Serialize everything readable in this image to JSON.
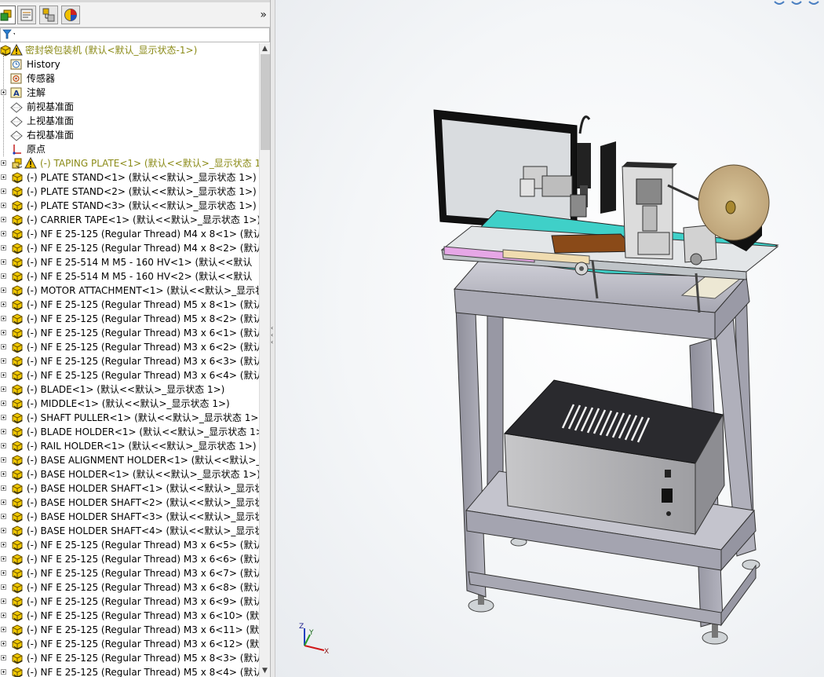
{
  "tree": {
    "root_label": "密封袋包装机 (默认<默认_显示状态-1>)",
    "items": [
      {
        "label": "History",
        "icon": "history-icon",
        "expandable": false
      },
      {
        "label": "传感器",
        "icon": "sensor-icon",
        "expandable": false
      },
      {
        "label": "注解",
        "icon": "annotation-icon",
        "expandable": true
      },
      {
        "label": "前视基准面",
        "icon": "plane-icon",
        "expandable": false
      },
      {
        "label": "上视基准面",
        "icon": "plane-icon",
        "expandable": false
      },
      {
        "label": "右视基准面",
        "icon": "plane-icon",
        "expandable": false
      },
      {
        "label": "原点",
        "icon": "origin-icon",
        "expandable": false
      },
      {
        "label": "(-) TAPING PLATE<1> (默认<<默认>_显示状态 1>",
        "icon": "subassembly-icon",
        "expandable": true,
        "warning": true
      },
      {
        "label": "(-) PLATE STAND<1> (默认<<默认>_显示状态 1>)",
        "icon": "part-icon",
        "expandable": true
      },
      {
        "label": "(-) PLATE STAND<2> (默认<<默认>_显示状态 1>)",
        "icon": "part-icon",
        "expandable": true
      },
      {
        "label": "(-) PLATE STAND<3> (默认<<默认>_显示状态 1>)",
        "icon": "part-icon",
        "expandable": true
      },
      {
        "label": "(-) CARRIER TAPE<1> (默认<<默认>_显示状态 1>)",
        "icon": "part-icon",
        "expandable": true
      },
      {
        "label": "(-) NF E 25-125  (Regular Thread) M4 x 8<1> (默认",
        "icon": "part-icon",
        "expandable": true
      },
      {
        "label": "(-) NF E 25-125  (Regular Thread) M4 x 8<2> (默认",
        "icon": "part-icon",
        "expandable": true
      },
      {
        "label": "(-) NF E 25-514  M M5  -  160 HV<1> (默认<<默认",
        "icon": "part-icon",
        "expandable": true
      },
      {
        "label": "(-) NF E 25-514  M M5  -  160 HV<2> (默认<<默认",
        "icon": "part-icon",
        "expandable": true
      },
      {
        "label": "(-) MOTOR ATTACHMENT<1> (默认<<默认>_显示状",
        "icon": "part-icon",
        "expandable": true
      },
      {
        "label": "(-) NF E 25-125  (Regular Thread) M5 x 8<1> (默认",
        "icon": "part-icon",
        "expandable": true
      },
      {
        "label": "(-) NF E 25-125  (Regular Thread) M5 x 8<2> (默认",
        "icon": "part-icon",
        "expandable": true
      },
      {
        "label": "(-) NF E 25-125  (Regular Thread) M3 x 6<1> (默认",
        "icon": "part-icon",
        "expandable": true
      },
      {
        "label": "(-) NF E 25-125  (Regular Thread) M3 x 6<2> (默认",
        "icon": "part-icon",
        "expandable": true
      },
      {
        "label": "(-) NF E 25-125  (Regular Thread) M3 x 6<3> (默认",
        "icon": "part-icon",
        "expandable": true
      },
      {
        "label": "(-) NF E 25-125  (Regular Thread) M3 x 6<4> (默认",
        "icon": "part-icon",
        "expandable": true
      },
      {
        "label": "(-) BLADE<1> (默认<<默认>_显示状态 1>)",
        "icon": "part-icon",
        "expandable": true
      },
      {
        "label": "(-) MIDDLE<1> (默认<<默认>_显示状态 1>)",
        "icon": "part-icon",
        "expandable": true
      },
      {
        "label": "(-) SHAFT PULLER<1> (默认<<默认>_显示状态 1>)",
        "icon": "part-icon",
        "expandable": true
      },
      {
        "label": "(-) BLADE HOLDER<1> (默认<<默认>_显示状态 1>)",
        "icon": "part-icon",
        "expandable": true
      },
      {
        "label": "(-) RAIL HOLDER<1> (默认<<默认>_显示状态 1>)",
        "icon": "part-icon",
        "expandable": true
      },
      {
        "label": "(-) BASE ALIGNMENT HOLDER<1> (默认<<默认>_显",
        "icon": "part-icon",
        "expandable": true
      },
      {
        "label": "(-) BASE HOLDER<1> (默认<<默认>_显示状态 1>)",
        "icon": "part-icon",
        "expandable": true
      },
      {
        "label": "(-) BASE HOLDER SHAFT<1> (默认<<默认>_显示状态",
        "icon": "part-icon",
        "expandable": true
      },
      {
        "label": "(-) BASE HOLDER SHAFT<2> (默认<<默认>_显示状态",
        "icon": "part-icon",
        "expandable": true
      },
      {
        "label": "(-) BASE HOLDER SHAFT<3> (默认<<默认>_显示状态",
        "icon": "part-icon",
        "expandable": true
      },
      {
        "label": "(-) BASE HOLDER SHAFT<4> (默认<<默认>_显示状态",
        "icon": "part-icon",
        "expandable": true
      },
      {
        "label": "(-) NF E 25-125  (Regular Thread) M3 x 6<5> (默认",
        "icon": "part-icon",
        "expandable": true
      },
      {
        "label": "(-) NF E 25-125  (Regular Thread) M3 x 6<6> (默认",
        "icon": "part-icon",
        "expandable": true
      },
      {
        "label": "(-) NF E 25-125  (Regular Thread) M3 x 6<7> (默认",
        "icon": "part-icon",
        "expandable": true
      },
      {
        "label": "(-) NF E 25-125  (Regular Thread) M3 x 6<8> (默认",
        "icon": "part-icon",
        "expandable": true
      },
      {
        "label": "(-) NF E 25-125  (Regular Thread) M3 x 6<9> (默认",
        "icon": "part-icon",
        "expandable": true
      },
      {
        "label": "(-) NF E 25-125  (Regular Thread) M3 x 6<10> (默认",
        "icon": "part-icon",
        "expandable": true
      },
      {
        "label": "(-) NF E 25-125  (Regular Thread) M3 x 6<11> (默认",
        "icon": "part-icon",
        "expandable": true
      },
      {
        "label": "(-) NF E 25-125  (Regular Thread) M3 x 6<12> (默认",
        "icon": "part-icon",
        "expandable": true
      },
      {
        "label": "(-) NF E 25-125  (Regular Thread) M5 x 8<3> (默认",
        "icon": "part-icon",
        "expandable": true
      },
      {
        "label": "(-) NF E 25-125  (Regular Thread) M5 x 8<4> (默认",
        "icon": "part-icon",
        "expandable": true
      }
    ]
  },
  "tabs": [
    {
      "name": "feature-manager-tab",
      "active": true
    },
    {
      "name": "property-manager-tab",
      "active": false
    },
    {
      "name": "configuration-manager-tab",
      "active": false
    },
    {
      "name": "display-manager-tab",
      "active": false
    }
  ],
  "panel": {
    "expand_symbol": "»"
  },
  "triad": {
    "x": "X",
    "y": "Y",
    "z": "Z"
  },
  "colors": {
    "warning": "#f2c000",
    "part_yellow": "#f0c800",
    "frame_gray": "#a9a9b4",
    "accent_teal": "#3fd0c8"
  }
}
